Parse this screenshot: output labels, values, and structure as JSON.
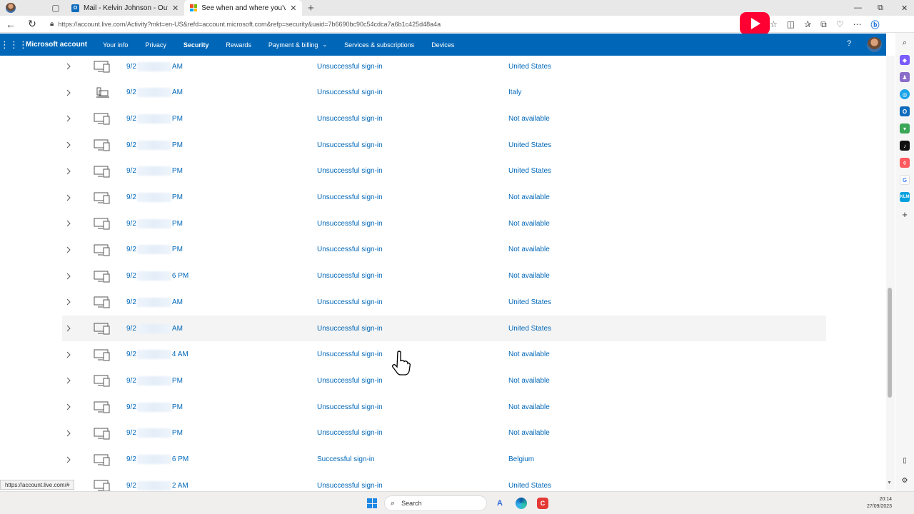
{
  "browser": {
    "tabs": [
      {
        "title": "Mail - Kelvin Johnson - Outlook",
        "active": false
      },
      {
        "title": "See when and where you've used",
        "active": true
      }
    ],
    "url": "https://account.live.com/Activity?mkt=en-US&refd=account.microsoft.com&refp=security&uaid=7b6690bc90c54cdca7a6b1c425d48a4a",
    "status_url": "https://account.live.com/#"
  },
  "header": {
    "brand": "Microsoft account",
    "nav": [
      {
        "label": "Your info",
        "active": false
      },
      {
        "label": "Privacy",
        "active": false
      },
      {
        "label": "Security",
        "active": true
      },
      {
        "label": "Rewards",
        "active": false
      },
      {
        "label": "Payment & billing",
        "active": false,
        "dropdown": true
      },
      {
        "label": "Services & subscriptions",
        "active": false
      },
      {
        "label": "Devices",
        "active": false
      }
    ],
    "help": "?"
  },
  "activity": [
    {
      "date_start": "9/2",
      "date_end": "AM",
      "event": "Unsuccessful sign-in",
      "location": "United States",
      "device": "multi"
    },
    {
      "date_start": "9/2",
      "date_end": "AM",
      "event": "Unsuccessful sign-in",
      "location": "Italy",
      "device": "laptop"
    },
    {
      "date_start": "9/2",
      "date_end": "PM",
      "event": "Unsuccessful sign-in",
      "location": "Not available",
      "device": "multi"
    },
    {
      "date_start": "9/2",
      "date_end": "PM",
      "event": "Unsuccessful sign-in",
      "location": "United States",
      "device": "multi"
    },
    {
      "date_start": "9/2",
      "date_end": "PM",
      "event": "Unsuccessful sign-in",
      "location": "United States",
      "device": "multi"
    },
    {
      "date_start": "9/2",
      "date_end": "PM",
      "event": "Unsuccessful sign-in",
      "location": "Not available",
      "device": "multi"
    },
    {
      "date_start": "9/2",
      "date_end": "PM",
      "event": "Unsuccessful sign-in",
      "location": "Not available",
      "device": "multi"
    },
    {
      "date_start": "9/2",
      "date_end": "PM",
      "event": "Unsuccessful sign-in",
      "location": "Not available",
      "device": "multi"
    },
    {
      "date_start": "9/2",
      "date_end": "6 PM",
      "event": "Unsuccessful sign-in",
      "location": "Not available",
      "device": "multi"
    },
    {
      "date_start": "9/2",
      "date_end": "AM",
      "event": "Unsuccessful sign-in",
      "location": "United States",
      "device": "multi"
    },
    {
      "date_start": "9/2",
      "date_end": "AM",
      "event": "Unsuccessful sign-in",
      "location": "United States",
      "device": "multi",
      "hover": true
    },
    {
      "date_start": "9/2",
      "date_end": "4 AM",
      "event": "Unsuccessful sign-in",
      "location": "Not available",
      "device": "multi"
    },
    {
      "date_start": "9/2",
      "date_end": "PM",
      "event": "Unsuccessful sign-in",
      "location": "Not available",
      "device": "multi"
    },
    {
      "date_start": "9/2",
      "date_end": "PM",
      "event": "Unsuccessful sign-in",
      "location": "Not available",
      "device": "multi"
    },
    {
      "date_start": "9/2",
      "date_end": "PM",
      "event": "Unsuccessful sign-in",
      "location": "Not available",
      "device": "multi"
    },
    {
      "date_start": "9/2",
      "date_end": "6 PM",
      "event": "Successful sign-in",
      "location": "Belgium",
      "device": "multi"
    },
    {
      "date_start": "9/2",
      "date_end": "2 AM",
      "event": "Unsuccessful sign-in",
      "location": "United States",
      "device": "multi"
    }
  ],
  "taskbar": {
    "search_label": "Search",
    "time": "20:14",
    "date": "27/09/2023"
  },
  "colors": {
    "brand_blue": "#0067b8",
    "link_blue": "#0067b8",
    "youtube_red": "#ff0033"
  }
}
